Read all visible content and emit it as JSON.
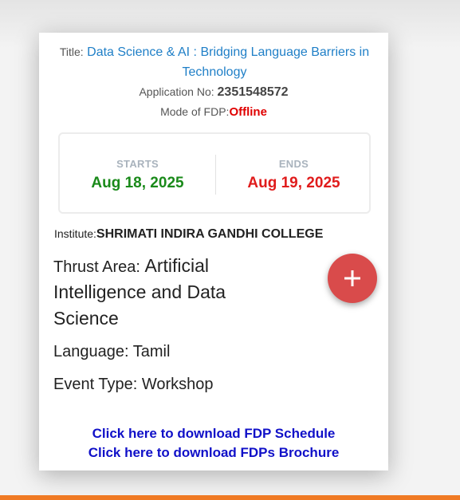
{
  "fdp": {
    "title_label": "Title:",
    "title": "Data Science & AI : Bridging Language Barriers in Technology",
    "application_label": "Application No:",
    "application_no": "2351548572",
    "mode_label": "Mode of FDP:",
    "mode": "Offline",
    "starts_label": "STARTS",
    "starts_date": "Aug 18, 2025",
    "ends_label": "ENDS",
    "ends_date": "Aug 19, 2025",
    "institute_label": "Institute:",
    "institute": "SHRIMATI INDIRA GANDHI COLLEGE",
    "thrust_label": "Thrust Area:",
    "thrust_area": "Artificial Intelligence and Data Science",
    "language_label": "Language:",
    "language": "Tamil",
    "event_type_label": "Event Type:",
    "event_type": "Workshop",
    "schedule_link": "Click here to download FDP Schedule",
    "brochure_link": "Click here to download FDPs Brochure",
    "add_icon": "plus-icon"
  },
  "colors": {
    "title_blue": "#1f7fc7",
    "offline_red": "#e00000",
    "start_green": "#1a8a1a",
    "end_red": "#e01c1c",
    "fab_red": "#d94b4b",
    "link_blue": "#1010c8",
    "bottom_bar_orange": "#f07a24"
  }
}
